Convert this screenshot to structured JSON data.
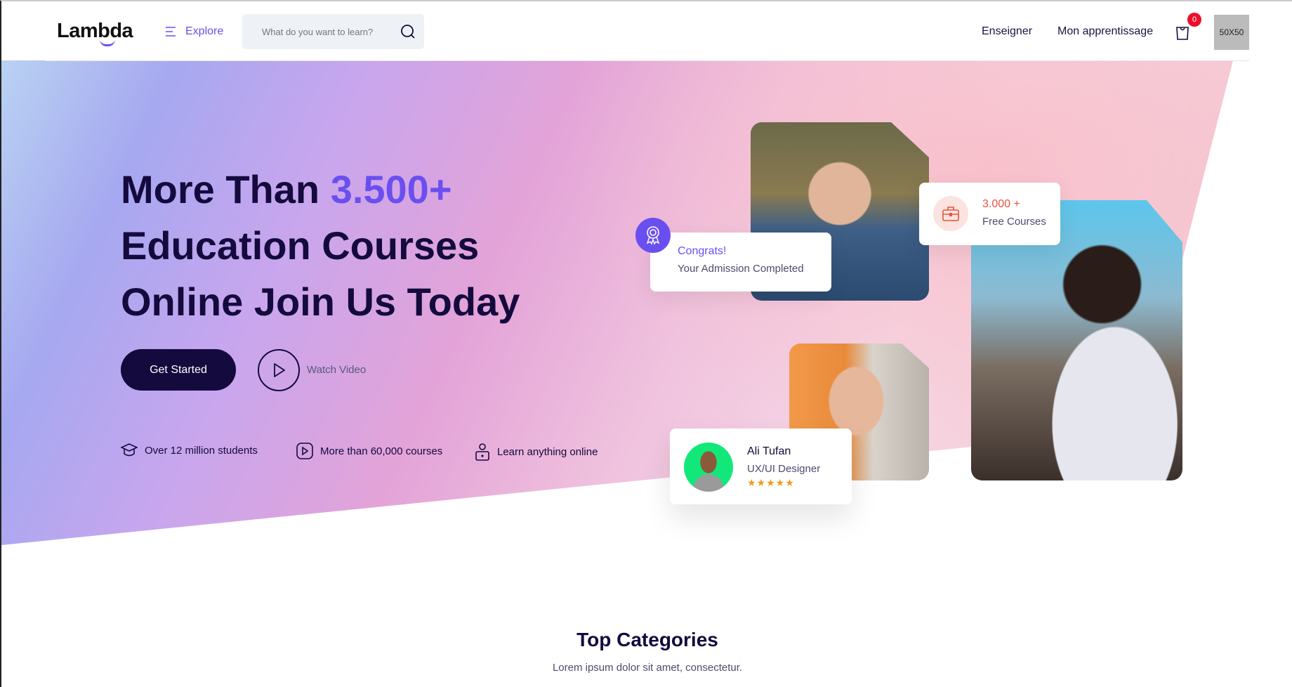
{
  "nav": {
    "logo": "Lambda",
    "explore": "Explore",
    "search_placeholder": "What do you want to learn?",
    "links": [
      "Enseigner",
      "Mon apprentissage"
    ],
    "cart_count": "0",
    "avatar": "50X50"
  },
  "hero": {
    "line1_a": "More Than ",
    "line1_accent": "3.500+",
    "line2": "Education Courses",
    "line3": "Online Join Us Today",
    "get_started": "Get Started",
    "watch_video": "Watch Video",
    "features": [
      {
        "icon": "graduation-cap-icon",
        "text": "Over 12 million students"
      },
      {
        "icon": "play-icon",
        "text": "More than 60,000 courses"
      },
      {
        "icon": "user-lock-icon",
        "text": "Learn anything online"
      }
    ]
  },
  "cards": {
    "congrats_title": "Congrats!",
    "congrats_sub": "Your Admission Completed",
    "courses_count": "3.000 +",
    "courses_label": "Free Courses",
    "instructor_name": "Ali Tufan",
    "instructor_role": "UX/UI Designer",
    "rating": 5
  },
  "categories": {
    "title": "Top Categories",
    "subtitle": "Lorem ipsum dolor sit amet, consectetur."
  },
  "colors": {
    "accent": "#6a4ff0",
    "dark": "#140a3d",
    "badge": "#e8112d",
    "orange": "#e8533f",
    "star": "#f29a1e"
  }
}
